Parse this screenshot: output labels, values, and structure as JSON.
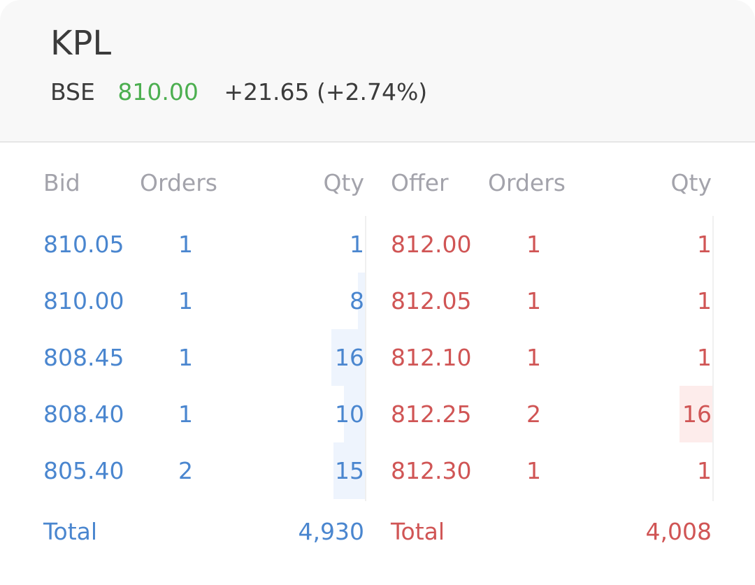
{
  "header": {
    "symbol": "KPL",
    "exchange": "BSE",
    "ltp": "810.00",
    "change": "+21.65 (+2.74%)"
  },
  "columns": {
    "bid": "Bid",
    "bid_orders": "Orders",
    "bid_qty": "Qty",
    "offer": "Offer",
    "offer_orders": "Orders",
    "offer_qty": "Qty"
  },
  "bids": [
    {
      "price": "810.05",
      "orders": "1",
      "qty": "1"
    },
    {
      "price": "810.00",
      "orders": "1",
      "qty": "8"
    },
    {
      "price": "808.45",
      "orders": "1",
      "qty": "16"
    },
    {
      "price": "808.40",
      "orders": "1",
      "qty": "10"
    },
    {
      "price": "805.40",
      "orders": "2",
      "qty": "15"
    }
  ],
  "offers": [
    {
      "price": "812.00",
      "orders": "1",
      "qty": "1"
    },
    {
      "price": "812.05",
      "orders": "1",
      "qty": "1"
    },
    {
      "price": "812.10",
      "orders": "1",
      "qty": "1"
    },
    {
      "price": "812.25",
      "orders": "2",
      "qty": "16"
    },
    {
      "price": "812.30",
      "orders": "1",
      "qty": "1"
    }
  ],
  "totals": {
    "bid_label": "Total",
    "bid_total": "4,930",
    "offer_label": "Total",
    "offer_total": "4,008"
  },
  "colors": {
    "bid": "#4a86cf",
    "offer": "#d05555",
    "ltp_up": "#4caf50"
  }
}
